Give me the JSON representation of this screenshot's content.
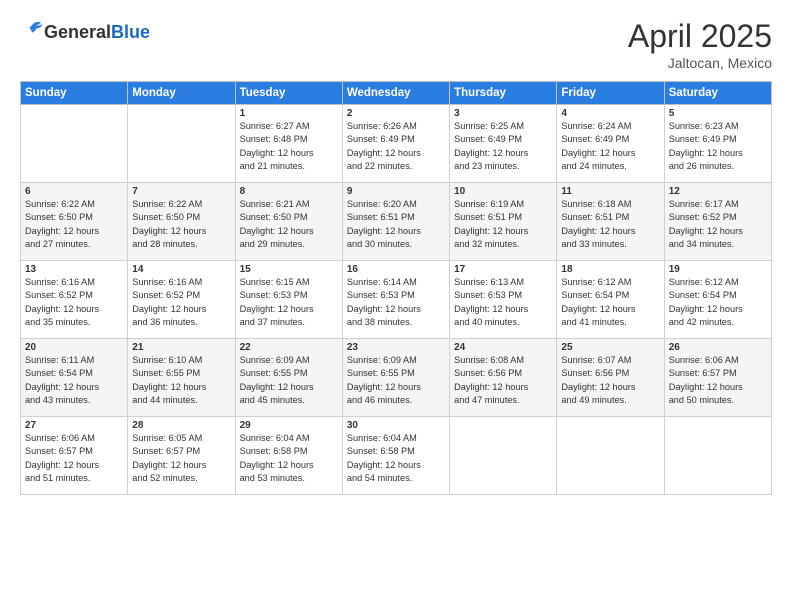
{
  "header": {
    "logo_general": "General",
    "logo_blue": "Blue",
    "title": "April 2025",
    "location": "Jaltocan, Mexico"
  },
  "days_of_week": [
    "Sunday",
    "Monday",
    "Tuesday",
    "Wednesday",
    "Thursday",
    "Friday",
    "Saturday"
  ],
  "weeks": [
    [
      {
        "day": "",
        "info": ""
      },
      {
        "day": "",
        "info": ""
      },
      {
        "day": "1",
        "sunrise": "6:27 AM",
        "sunset": "6:48 PM",
        "daylight": "12 hours and 21 minutes."
      },
      {
        "day": "2",
        "sunrise": "6:26 AM",
        "sunset": "6:49 PM",
        "daylight": "12 hours and 22 minutes."
      },
      {
        "day": "3",
        "sunrise": "6:25 AM",
        "sunset": "6:49 PM",
        "daylight": "12 hours and 23 minutes."
      },
      {
        "day": "4",
        "sunrise": "6:24 AM",
        "sunset": "6:49 PM",
        "daylight": "12 hours and 24 minutes."
      },
      {
        "day": "5",
        "sunrise": "6:23 AM",
        "sunset": "6:49 PM",
        "daylight": "12 hours and 26 minutes."
      }
    ],
    [
      {
        "day": "6",
        "sunrise": "6:22 AM",
        "sunset": "6:50 PM",
        "daylight": "12 hours and 27 minutes."
      },
      {
        "day": "7",
        "sunrise": "6:22 AM",
        "sunset": "6:50 PM",
        "daylight": "12 hours and 28 minutes."
      },
      {
        "day": "8",
        "sunrise": "6:21 AM",
        "sunset": "6:50 PM",
        "daylight": "12 hours and 29 minutes."
      },
      {
        "day": "9",
        "sunrise": "6:20 AM",
        "sunset": "6:51 PM",
        "daylight": "12 hours and 30 minutes."
      },
      {
        "day": "10",
        "sunrise": "6:19 AM",
        "sunset": "6:51 PM",
        "daylight": "12 hours and 32 minutes."
      },
      {
        "day": "11",
        "sunrise": "6:18 AM",
        "sunset": "6:51 PM",
        "daylight": "12 hours and 33 minutes."
      },
      {
        "day": "12",
        "sunrise": "6:17 AM",
        "sunset": "6:52 PM",
        "daylight": "12 hours and 34 minutes."
      }
    ],
    [
      {
        "day": "13",
        "sunrise": "6:16 AM",
        "sunset": "6:52 PM",
        "daylight": "12 hours and 35 minutes."
      },
      {
        "day": "14",
        "sunrise": "6:16 AM",
        "sunset": "6:52 PM",
        "daylight": "12 hours and 36 minutes."
      },
      {
        "day": "15",
        "sunrise": "6:15 AM",
        "sunset": "6:53 PM",
        "daylight": "12 hours and 37 minutes."
      },
      {
        "day": "16",
        "sunrise": "6:14 AM",
        "sunset": "6:53 PM",
        "daylight": "12 hours and 38 minutes."
      },
      {
        "day": "17",
        "sunrise": "6:13 AM",
        "sunset": "6:53 PM",
        "daylight": "12 hours and 40 minutes."
      },
      {
        "day": "18",
        "sunrise": "6:12 AM",
        "sunset": "6:54 PM",
        "daylight": "12 hours and 41 minutes."
      },
      {
        "day": "19",
        "sunrise": "6:12 AM",
        "sunset": "6:54 PM",
        "daylight": "12 hours and 42 minutes."
      }
    ],
    [
      {
        "day": "20",
        "sunrise": "6:11 AM",
        "sunset": "6:54 PM",
        "daylight": "12 hours and 43 minutes."
      },
      {
        "day": "21",
        "sunrise": "6:10 AM",
        "sunset": "6:55 PM",
        "daylight": "12 hours and 44 minutes."
      },
      {
        "day": "22",
        "sunrise": "6:09 AM",
        "sunset": "6:55 PM",
        "daylight": "12 hours and 45 minutes."
      },
      {
        "day": "23",
        "sunrise": "6:09 AM",
        "sunset": "6:55 PM",
        "daylight": "12 hours and 46 minutes."
      },
      {
        "day": "24",
        "sunrise": "6:08 AM",
        "sunset": "6:56 PM",
        "daylight": "12 hours and 47 minutes."
      },
      {
        "day": "25",
        "sunrise": "6:07 AM",
        "sunset": "6:56 PM",
        "daylight": "12 hours and 49 minutes."
      },
      {
        "day": "26",
        "sunrise": "6:06 AM",
        "sunset": "6:57 PM",
        "daylight": "12 hours and 50 minutes."
      }
    ],
    [
      {
        "day": "27",
        "sunrise": "6:06 AM",
        "sunset": "6:57 PM",
        "daylight": "12 hours and 51 minutes."
      },
      {
        "day": "28",
        "sunrise": "6:05 AM",
        "sunset": "6:57 PM",
        "daylight": "12 hours and 52 minutes."
      },
      {
        "day": "29",
        "sunrise": "6:04 AM",
        "sunset": "6:58 PM",
        "daylight": "12 hours and 53 minutes."
      },
      {
        "day": "30",
        "sunrise": "6:04 AM",
        "sunset": "6:58 PM",
        "daylight": "12 hours and 54 minutes."
      },
      {
        "day": "",
        "info": ""
      },
      {
        "day": "",
        "info": ""
      },
      {
        "day": "",
        "info": ""
      }
    ]
  ],
  "labels": {
    "sunrise": "Sunrise:",
    "sunset": "Sunset:",
    "daylight": "Daylight:"
  }
}
